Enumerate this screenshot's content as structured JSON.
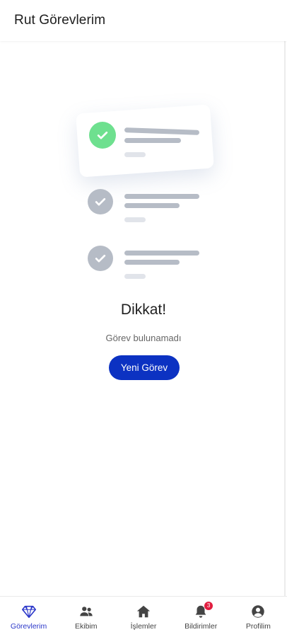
{
  "header": {
    "title": "Rut Görevlerim"
  },
  "empty_state": {
    "title": "Dikkat!",
    "subtitle": "Görev bulunamadı",
    "button_label": "Yeni Görev"
  },
  "tabbar": {
    "items": [
      {
        "label": "Görevlerim",
        "icon": "diamond-icon",
        "active": true
      },
      {
        "label": "Ekibim",
        "icon": "team-icon",
        "active": false
      },
      {
        "label": "İşlemler",
        "icon": "home-icon",
        "active": false
      },
      {
        "label": "Bildirimler",
        "icon": "bell-icon",
        "active": false,
        "badge": "3"
      },
      {
        "label": "Profilim",
        "icon": "profile-icon",
        "active": false
      }
    ]
  },
  "colors": {
    "accent": "#0c32c2",
    "active_tab": "#2a36c9",
    "check_green": "#6ee08f",
    "check_grey": "#b6bcc6",
    "badge": "#e11d3f"
  }
}
